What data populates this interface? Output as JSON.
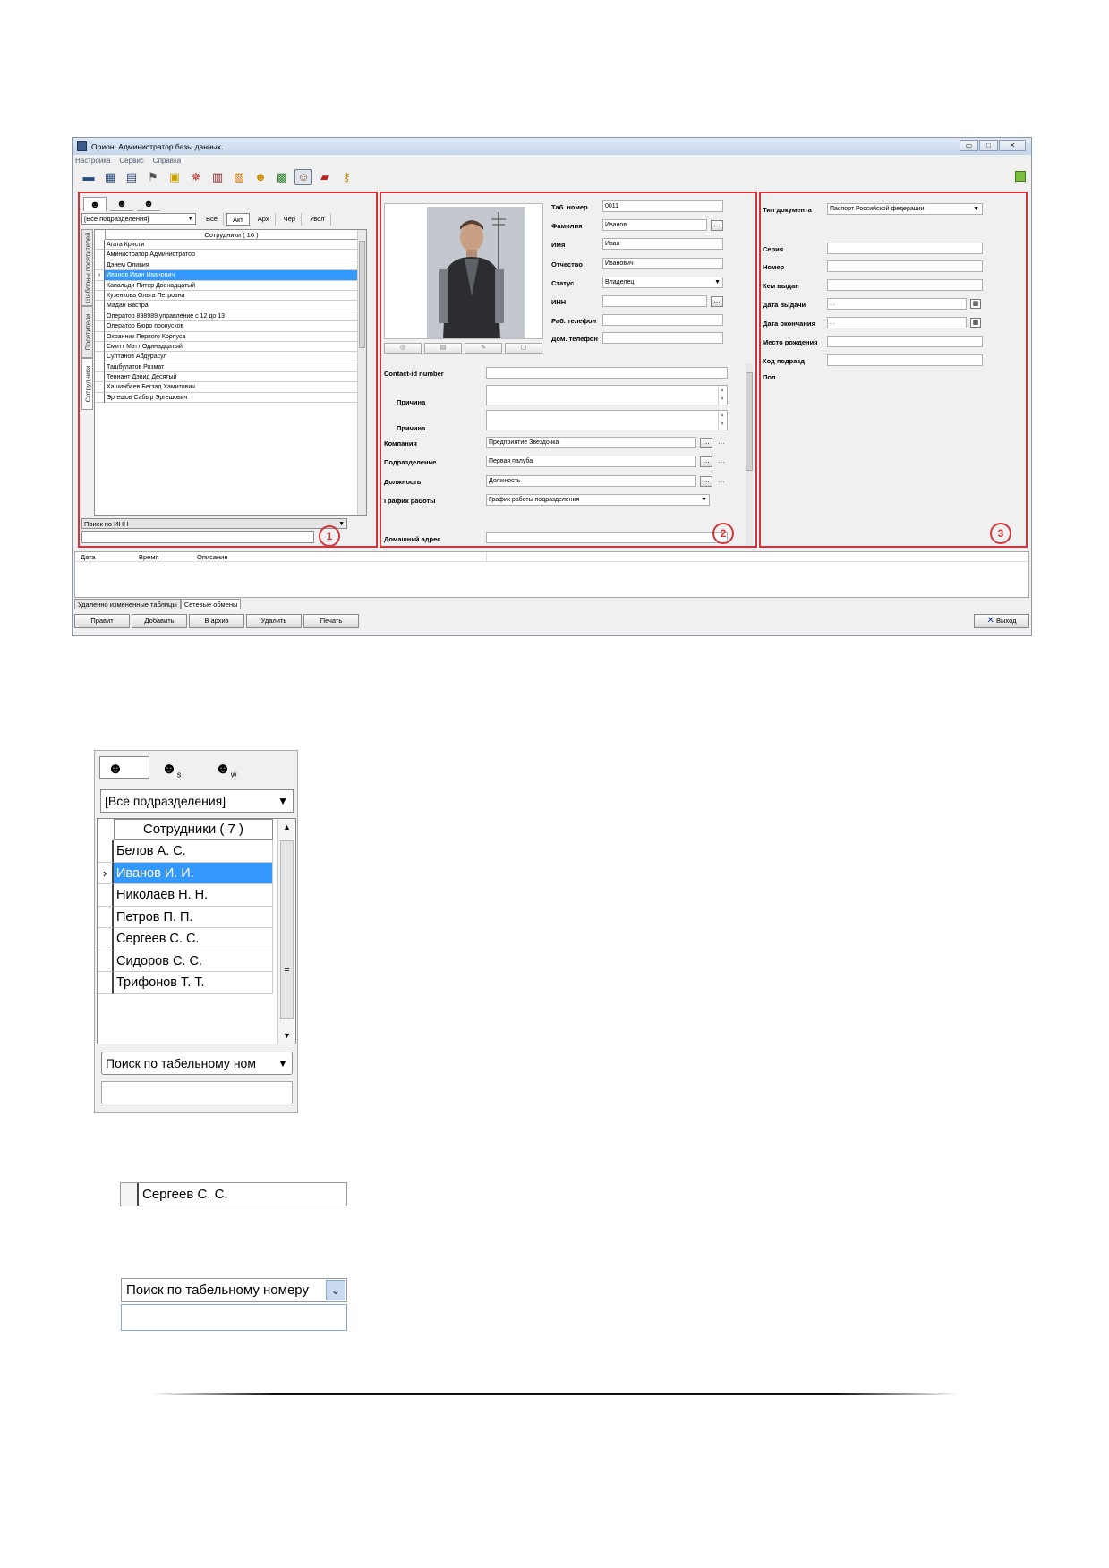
{
  "window": {
    "title": "Орион. Администратор базы данных.",
    "menu": [
      "Настройка",
      "Сервис",
      "Справка"
    ],
    "toolbar_icons": [
      "monitor-icon",
      "film-icon",
      "calendar-icon",
      "signpost-icon",
      "note-icon",
      "wheel-icon",
      "books-icon",
      "clipboard-icon",
      "person-key-icon",
      "map-icon",
      "people-icon",
      "car-icon",
      "keys-icon"
    ]
  },
  "panel1": {
    "department": "[Все подразделения]",
    "filters": [
      "Все",
      "Акт",
      "Арх",
      "Чер",
      "Увол"
    ],
    "vertical_tabs": [
      "Сотрудники",
      "Посетители",
      "Шаблоны посетителей"
    ],
    "grid_header": "Сотрудники  ( 16 )",
    "employees": [
      "Агата Кристи",
      "Аминистратор Администратор",
      "Дэнем Оливия",
      "Иванов Иван Иванович",
      "Капальди Питер Двенадцатый",
      "Кузенкова Ольга Петровна",
      "Мадан Вастра",
      "Оператор 898989 управление с 12 до 13",
      "Оператор Бюро пропусков",
      "Охранник Первого Корпуса",
      "Смитт Мэтт Одинадцатый",
      "Султанов Абдурасул",
      "Ташбулатов Розмат",
      "Теннант  Дэвид  Десятый",
      "Хашинбаев Бегзад Хамитович",
      "Эргешов Сабыр Эргешович"
    ],
    "selected_index": 3,
    "search_mode": "Поиск по ИНН",
    "badge": "1"
  },
  "panel2": {
    "fields": {
      "tab_label": "Таб. номер",
      "tab_value": "0011",
      "surname_label": "Фамилия",
      "surname_value": "Иванов",
      "name_label": "Имя",
      "name_value": "Иван",
      "patronymic_label": "Отчество",
      "patronymic_value": "Иванович",
      "status_label": "Статус",
      "status_value": "Владелец",
      "inn_label": "ИНН",
      "work_phone_label": "Раб. телефон",
      "home_phone_label": "Дом. телефон",
      "contact_label": "Contact-id number",
      "reason_label": "Причина",
      "company_label": "Компания",
      "company_value": "Предприятие Звездочка",
      "dept_label": "Подразделение",
      "dept_value": "Первая палуба",
      "position_label": "Должность",
      "position_value": "Должность",
      "schedule_label": "График работы",
      "schedule_value": "График работы подразделения",
      "address_label": "Домашний адрес"
    },
    "badge": "2"
  },
  "panel3": {
    "doc_type_label": "Тип документа",
    "doc_type_value": "Паспорт Российской федерации",
    "series_label": "Серия",
    "number_label": "Номер",
    "issued_by_label": "Кем выдан",
    "issue_date_label": "Дата выдачи",
    "issue_date_value": " .  .",
    "end_date_label": "Дата окончания",
    "end_date_value": " .  .",
    "birthplace_label": "Место рождения",
    "code_label": "Код подразд",
    "sex_label": "Пол",
    "badge": "3"
  },
  "log": {
    "columns": [
      "Дата",
      "Время",
      "Описание"
    ],
    "tabs": [
      "Удаленно измененные таблицы",
      "Сетевые обмены"
    ]
  },
  "actions": [
    "Правит",
    "Добавить",
    "В архив",
    "Удалить",
    "Печать"
  ],
  "exit_label": "Выход",
  "zoom": {
    "department": "[Все подразделения]",
    "grid_header": "Сотрудники  ( 7 )",
    "employees": [
      "Белов А. С.",
      "Иванов И. И.",
      "Николаев Н. Н.",
      "Петров П. П.",
      "Сергеев С. С.",
      "Сидоров С. С.",
      "Трифонов Т. Т."
    ],
    "selected_index": 1,
    "search_mode": "Поиск по табельному ном"
  },
  "item_example": "Сергеев С. С.",
  "search_example": "Поиск по табельному номеру"
}
